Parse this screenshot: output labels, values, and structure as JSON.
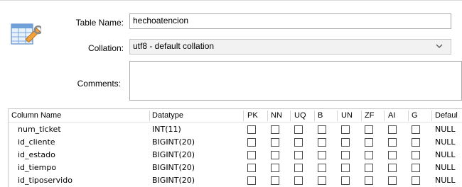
{
  "form": {
    "table_name_label": "Table Name:",
    "table_name_value": "hechoatencion",
    "collation_label": "Collation:",
    "collation_value": "utf8 - default collation",
    "comments_label": "Comments:",
    "comments_value": ""
  },
  "icons": {
    "table": "table-edit-icon",
    "dropdown": "chevron-down-icon",
    "checkbox": "checkbox-icon"
  },
  "columns_grid": {
    "headers": [
      "Column Name",
      "Datatype",
      "PK",
      "NN",
      "UQ",
      "B",
      "UN",
      "ZF",
      "AI",
      "G",
      "Defaul"
    ],
    "rows": [
      {
        "name": "num_ticket",
        "datatype": "INT(11)",
        "flags": [
          false,
          false,
          false,
          false,
          false,
          false,
          false,
          false
        ],
        "default": "NULL"
      },
      {
        "name": "id_cliente",
        "datatype": "BIGINT(20)",
        "flags": [
          false,
          false,
          false,
          false,
          false,
          false,
          false,
          false
        ],
        "default": "NULL"
      },
      {
        "name": "id_estado",
        "datatype": "BIGINT(20)",
        "flags": [
          false,
          false,
          false,
          false,
          false,
          false,
          false,
          false
        ],
        "default": "NULL"
      },
      {
        "name": "id_tiempo",
        "datatype": "BIGINT(20)",
        "flags": [
          false,
          false,
          false,
          false,
          false,
          false,
          false,
          false
        ],
        "default": "NULL"
      },
      {
        "name": "id_tiposervido",
        "datatype": "BIGINT(20)",
        "flags": [
          false,
          false,
          false,
          false,
          false,
          false,
          false,
          false
        ],
        "default": "NULL"
      }
    ]
  }
}
